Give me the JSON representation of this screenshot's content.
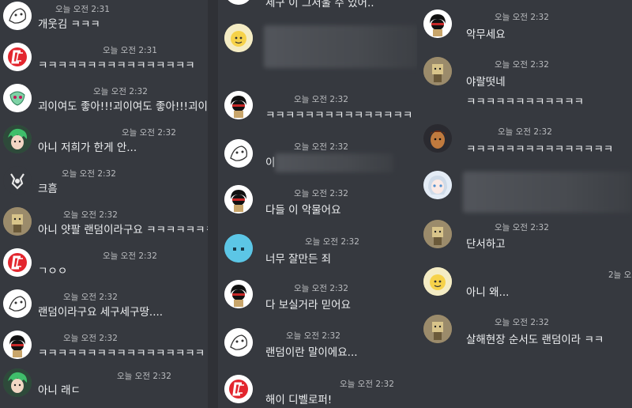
{
  "theme": {
    "background": "#36393f",
    "divider": "#2f3136",
    "text": "#eef0f2",
    "timestamp": "#b9bbbe"
  },
  "col1": {
    "messages": [
      {
        "time": "오늘 오전 2:31",
        "text": "개웃김 ㅋㅋㅋ",
        "avatar": "sketch-avatar-icon"
      },
      {
        "time": "오늘 오전 2:31",
        "text": "ㅋㅋㅋㅋㅋㅋㅋㅋㅋㅋㅋㅋㅋㅋㅋㅋ",
        "avatar": "red-logo-avatar-icon"
      },
      {
        "time": "오늘 오전 2:32",
        "text": "괴이여도 좋아!!!괴이여도 좋아!!!괴이여",
        "avatar": "green-drawing-avatar-icon"
      },
      {
        "time": "오늘 오전 2:32",
        "text": "아니 저희가 한게 안...",
        "avatar": "green-hair-avatar-icon"
      },
      {
        "time": "오늘 오전 2:32",
        "text": "크흠",
        "avatar": "dark-avatar-icon"
      },
      {
        "time": "오늘 오전 2:32",
        "text": "아니 얏팔 랜덤이라구요 ㅋㅋㅋㅋㅋㅋㅋ",
        "avatar": "doll-avatar-icon"
      },
      {
        "time": "오늘 오전 2:32",
        "text": "ㄱㅇㅇ",
        "avatar": "red-logo-avatar-icon"
      },
      {
        "time": "오늘 오전 2:32",
        "text": "랜덤이라구요 세구세구땅....",
        "avatar": "sketch-avatar-icon"
      },
      {
        "time": "오늘 오전 2:32",
        "text": "ㅋㅋㅋㅋㅋㅋㅋㅋㅋㅋㅋㅋㅋㅋㅋㅋㅋ",
        "avatar": "ninja-avatar-icon"
      },
      {
        "time": "오늘 오전 2:32",
        "text": "아니 래ㄷ",
        "avatar": "green-hair-avatar-icon"
      }
    ]
  },
  "col2": {
    "top_partial_text": "세구 이 그서울 수 있어..",
    "messages": [
      {
        "time": "",
        "text": "",
        "avatar": "yellow-character-avatar-icon"
      },
      {
        "time": "오늘 오전 2:32",
        "text": "ㅋㅋㅋㅋㅋㅋㅋㅋㅋㅋㅋㅋㅋㅋㅋ",
        "avatar": "ninja-avatar-icon"
      },
      {
        "time": "오늘 오전 2:32",
        "text": "이",
        "avatar": "sketch-avatar-icon"
      },
      {
        "time": "오늘 오전 2:32",
        "text": "다들 이 악물어요",
        "avatar": "ninja-avatar-icon"
      },
      {
        "time": "오늘 오전 2:32",
        "text": "너무 잘만든 죄",
        "avatar": "blue-blob-avatar-icon"
      },
      {
        "time": "오늘 오전 2:32",
        "text": "다 보실거라 믿어요",
        "avatar": "ninja-avatar-icon"
      },
      {
        "time": "오늘 오전 2:32",
        "text": "랜덤이란 말이에요...",
        "avatar": "sketch-avatar-icon"
      },
      {
        "time": "오늘 오전 2:32",
        "text": "해이 디벨로퍼!",
        "avatar": "red-logo-avatar-icon"
      }
    ]
  },
  "col3": {
    "messages": [
      {
        "time": "오늘 오전 2:32",
        "text": "악무세요",
        "avatar": "ninja-avatar-icon"
      },
      {
        "time": "오늘 오전 2:32",
        "text": "야랄떳네",
        "avatar": "doll-avatar-icon"
      },
      {
        "time": "",
        "text": "ㅋㅋㅋㅋㅋㅋㅋㅋㅋㅋㅋㅋ",
        "avatar": ""
      },
      {
        "time": "오늘 오전 2:32",
        "text": "ㅋㅋㅋㅋㅋㅋㅋㅋㅋㅋㅋㅋㅋㅋㅋ",
        "avatar": "tan-character-avatar-icon"
      },
      {
        "time": "",
        "text": "",
        "avatar": "anime-girl-avatar-icon"
      },
      {
        "time": "오늘 오전 2:32",
        "text": "단서하고",
        "avatar": "doll-avatar-icon"
      },
      {
        "time": "2늘 오",
        "text": "아니 왜...",
        "avatar": "yellow-character-avatar-icon"
      },
      {
        "time": "오늘 오전 2:32",
        "text": "살해현장 순서도 랜덤이라 ㅋㅋ",
        "avatar": "doll-avatar-icon"
      }
    ]
  }
}
